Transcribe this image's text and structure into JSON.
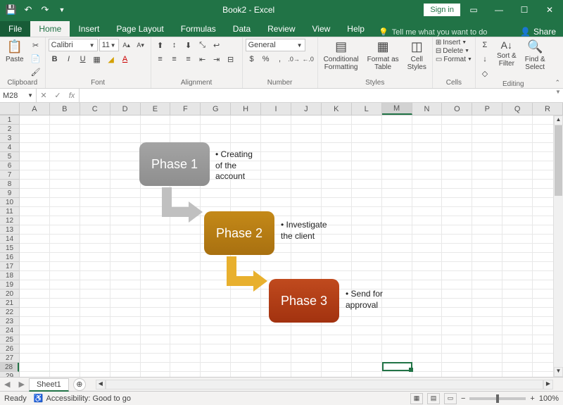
{
  "title": "Book2 - Excel",
  "signin": "Sign in",
  "tabs": {
    "file": "File",
    "home": "Home",
    "insert": "Insert",
    "page_layout": "Page Layout",
    "formulas": "Formulas",
    "data": "Data",
    "review": "Review",
    "view": "View",
    "help": "Help"
  },
  "tell_me": "Tell me what you want to do",
  "share": "Share",
  "ribbon": {
    "clipboard": {
      "label": "Clipboard",
      "paste": "Paste"
    },
    "font": {
      "label": "Font",
      "name": "Calibri",
      "size": "11"
    },
    "alignment": {
      "label": "Alignment"
    },
    "number": {
      "label": "Number",
      "format": "General"
    },
    "styles": {
      "label": "Styles",
      "cond": "Conditional\nFormatting",
      "table": "Format as\nTable",
      "cell": "Cell\nStyles"
    },
    "cells": {
      "label": "Cells",
      "insert": "Insert",
      "delete": "Delete",
      "format": "Format"
    },
    "editing": {
      "label": "Editing",
      "sort": "Sort &\nFilter",
      "find": "Find &\nSelect"
    }
  },
  "namebox": "M28",
  "columns": [
    "A",
    "B",
    "C",
    "D",
    "E",
    "F",
    "G",
    "H",
    "I",
    "J",
    "K",
    "L",
    "M",
    "N",
    "O",
    "P",
    "Q",
    "R"
  ],
  "row_count": 29,
  "active": {
    "col": 12,
    "row": 27
  },
  "smartart": {
    "p1": {
      "title": "Phase 1",
      "bullet": "Creating of the account"
    },
    "p2": {
      "title": "Phase 2",
      "bullet": "Investigate the client"
    },
    "p3": {
      "title": "Phase 3",
      "bullet": "Send for approval"
    }
  },
  "sheet": "Sheet1",
  "status": {
    "ready": "Ready",
    "accessibility": "Accessibility: Good to go",
    "zoom": "100%"
  }
}
